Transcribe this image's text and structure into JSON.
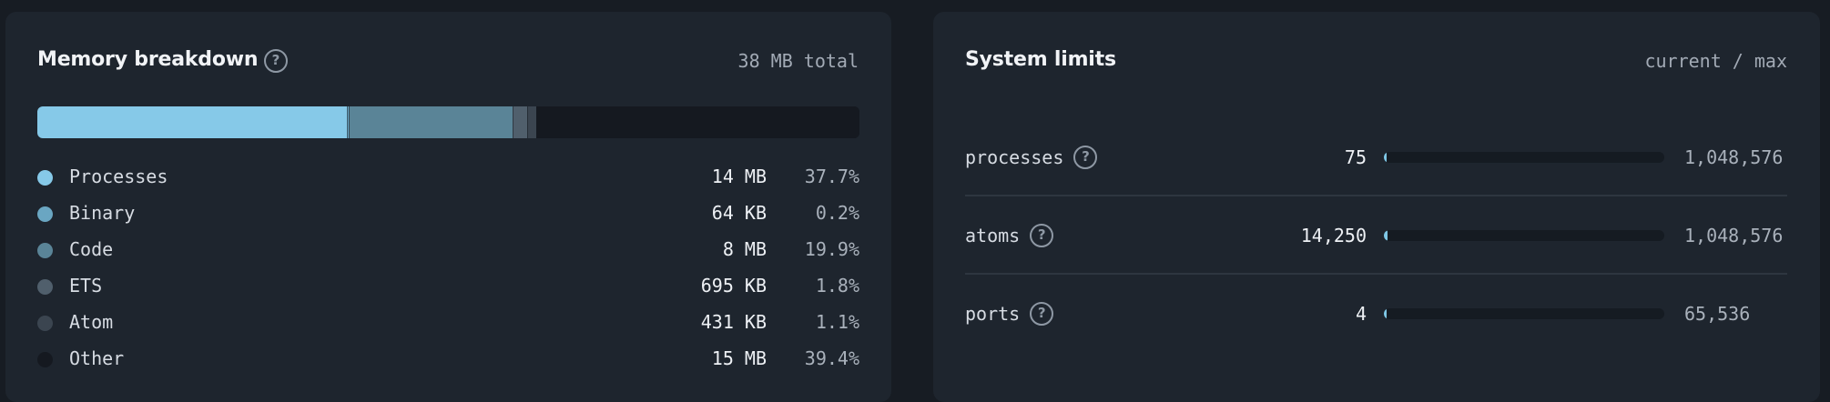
{
  "memory": {
    "title": "Memory breakdown",
    "total": "38 MB total",
    "colors": {
      "track": "#151920",
      "accent": "#86c9e8"
    },
    "items": [
      {
        "label": "Processes",
        "size": "14 MB",
        "percent": "37.7%",
        "share": 37.7,
        "color": "#86c9e8"
      },
      {
        "label": "Binary",
        "size": "64 KB",
        "percent": "0.2%",
        "share": 0.2,
        "color": "#6aa6c2"
      },
      {
        "label": "Code",
        "size": "8 MB",
        "percent": "19.9%",
        "share": 19.9,
        "color": "#5a8497"
      },
      {
        "label": "ETS",
        "size": "695 KB",
        "percent": "1.8%",
        "share": 1.8,
        "color": "#505f6c"
      },
      {
        "label": "Atom",
        "size": "431 KB",
        "percent": "1.1%",
        "share": 1.1,
        "color": "#3b4550"
      },
      {
        "label": "Other",
        "size": "15 MB",
        "percent": "39.4%",
        "share": 39.4,
        "color": "#151920"
      }
    ]
  },
  "limits": {
    "title": "System limits",
    "subtitle": "current / max",
    "items": [
      {
        "name": "processes",
        "current": "75",
        "max": "1,048,576",
        "current_num": 75,
        "max_num": 1048576
      },
      {
        "name": "atoms",
        "current": "14,250",
        "max": "1,048,576",
        "current_num": 14250,
        "max_num": 1048576
      },
      {
        "name": "ports",
        "current": "4",
        "max": "65,536",
        "current_num": 4,
        "max_num": 65536
      }
    ]
  },
  "icons": {
    "help": "?"
  }
}
